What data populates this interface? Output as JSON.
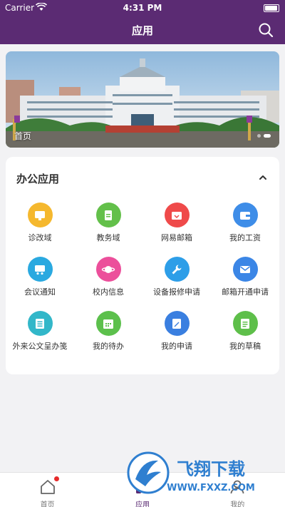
{
  "status_bar": {
    "carrier": "Carrier",
    "time": "4:31 PM"
  },
  "nav": {
    "title": "应用"
  },
  "banner": {
    "caption": "首页"
  },
  "office": {
    "title": "办公应用",
    "apps": [
      {
        "label": "诊改域",
        "icon": "monitor-icon",
        "color": "#f5b82e"
      },
      {
        "label": "教务域",
        "icon": "document-icon",
        "color": "#63c04a"
      },
      {
        "label": "网易邮箱",
        "icon": "mail-tray-icon",
        "color": "#ef4a4a"
      },
      {
        "label": "我的工资",
        "icon": "wallet-icon",
        "color": "#3e8de8"
      },
      {
        "label": "会议通知",
        "icon": "meeting-icon",
        "color": "#2aa9e0"
      },
      {
        "label": "校内信息",
        "icon": "planet-icon",
        "color": "#ec4f9b"
      },
      {
        "label": "设备报修申请",
        "icon": "wrench-icon",
        "color": "#2d9ee8"
      },
      {
        "label": "邮箱开通申请",
        "icon": "envelope-icon",
        "color": "#3b86e6"
      },
      {
        "label": "外来公文呈办笺",
        "icon": "list-icon",
        "color": "#32b7c9"
      },
      {
        "label": "我的待办",
        "icon": "calendar-icon",
        "color": "#5cc04c"
      },
      {
        "label": "我的申请",
        "icon": "edit-doc-icon",
        "color": "#3a7fe0"
      },
      {
        "label": "我的草稿",
        "icon": "draft-icon",
        "color": "#5ebf4a"
      }
    ]
  },
  "tabs": [
    {
      "label": "首页",
      "icon": "home-icon",
      "active": false
    },
    {
      "label": "应用",
      "icon": "apps-icon",
      "active": true
    },
    {
      "label": "我的",
      "icon": "profile-icon",
      "active": false
    }
  ],
  "watermark": {
    "brand": "飞翔下载",
    "url": "WWW.FXXZ.COM"
  },
  "colors": {
    "primary": "#5b2b73",
    "badge": "#e62a2a"
  }
}
